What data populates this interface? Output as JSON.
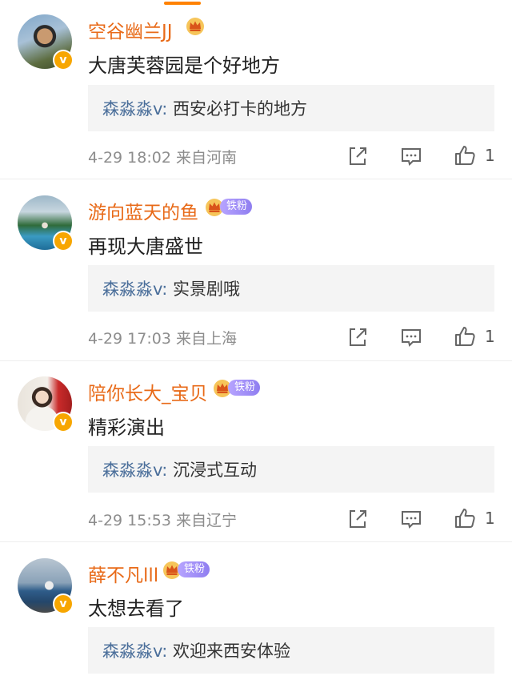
{
  "comments": [
    {
      "username": "空谷幽兰JJ",
      "fan_badge": "",
      "content": "大唐芙蓉园是个好地方",
      "reply_user": "森淼淼v:",
      "reply_text": "西安必打卡的地方",
      "time": "4-29 18:02",
      "source": "来自河南",
      "likes": "1"
    },
    {
      "username": "游向蓝天的鱼",
      "fan_badge": "铁粉",
      "content": "再现大唐盛世",
      "reply_user": "森淼淼v:",
      "reply_text": "实景剧哦",
      "time": "4-29 17:03",
      "source": "来自上海",
      "likes": "1"
    },
    {
      "username": "陪你长大_宝贝",
      "fan_badge": "铁粉",
      "content": "精彩演出",
      "reply_user": "森淼淼v:",
      "reply_text": "沉浸式互动",
      "time": "4-29 15:53",
      "source": "来自辽宁",
      "likes": "1"
    },
    {
      "username": "薛不凡lll",
      "fan_badge": "铁粉",
      "content": "太想去看了",
      "reply_user": "森淼淼v:",
      "reply_text": "欢迎来西安体验",
      "time": "",
      "source": "",
      "likes": ""
    }
  ],
  "verified_badge": "v",
  "icons": [
    "share-icon",
    "comment-icon",
    "like-icon",
    "crown-icon",
    "verified-badge"
  ],
  "colors": {
    "username": "#e86a18",
    "reply_user": "#4a6e9a",
    "accent": "#ff8200",
    "fan_badge": "#9b87f5"
  }
}
